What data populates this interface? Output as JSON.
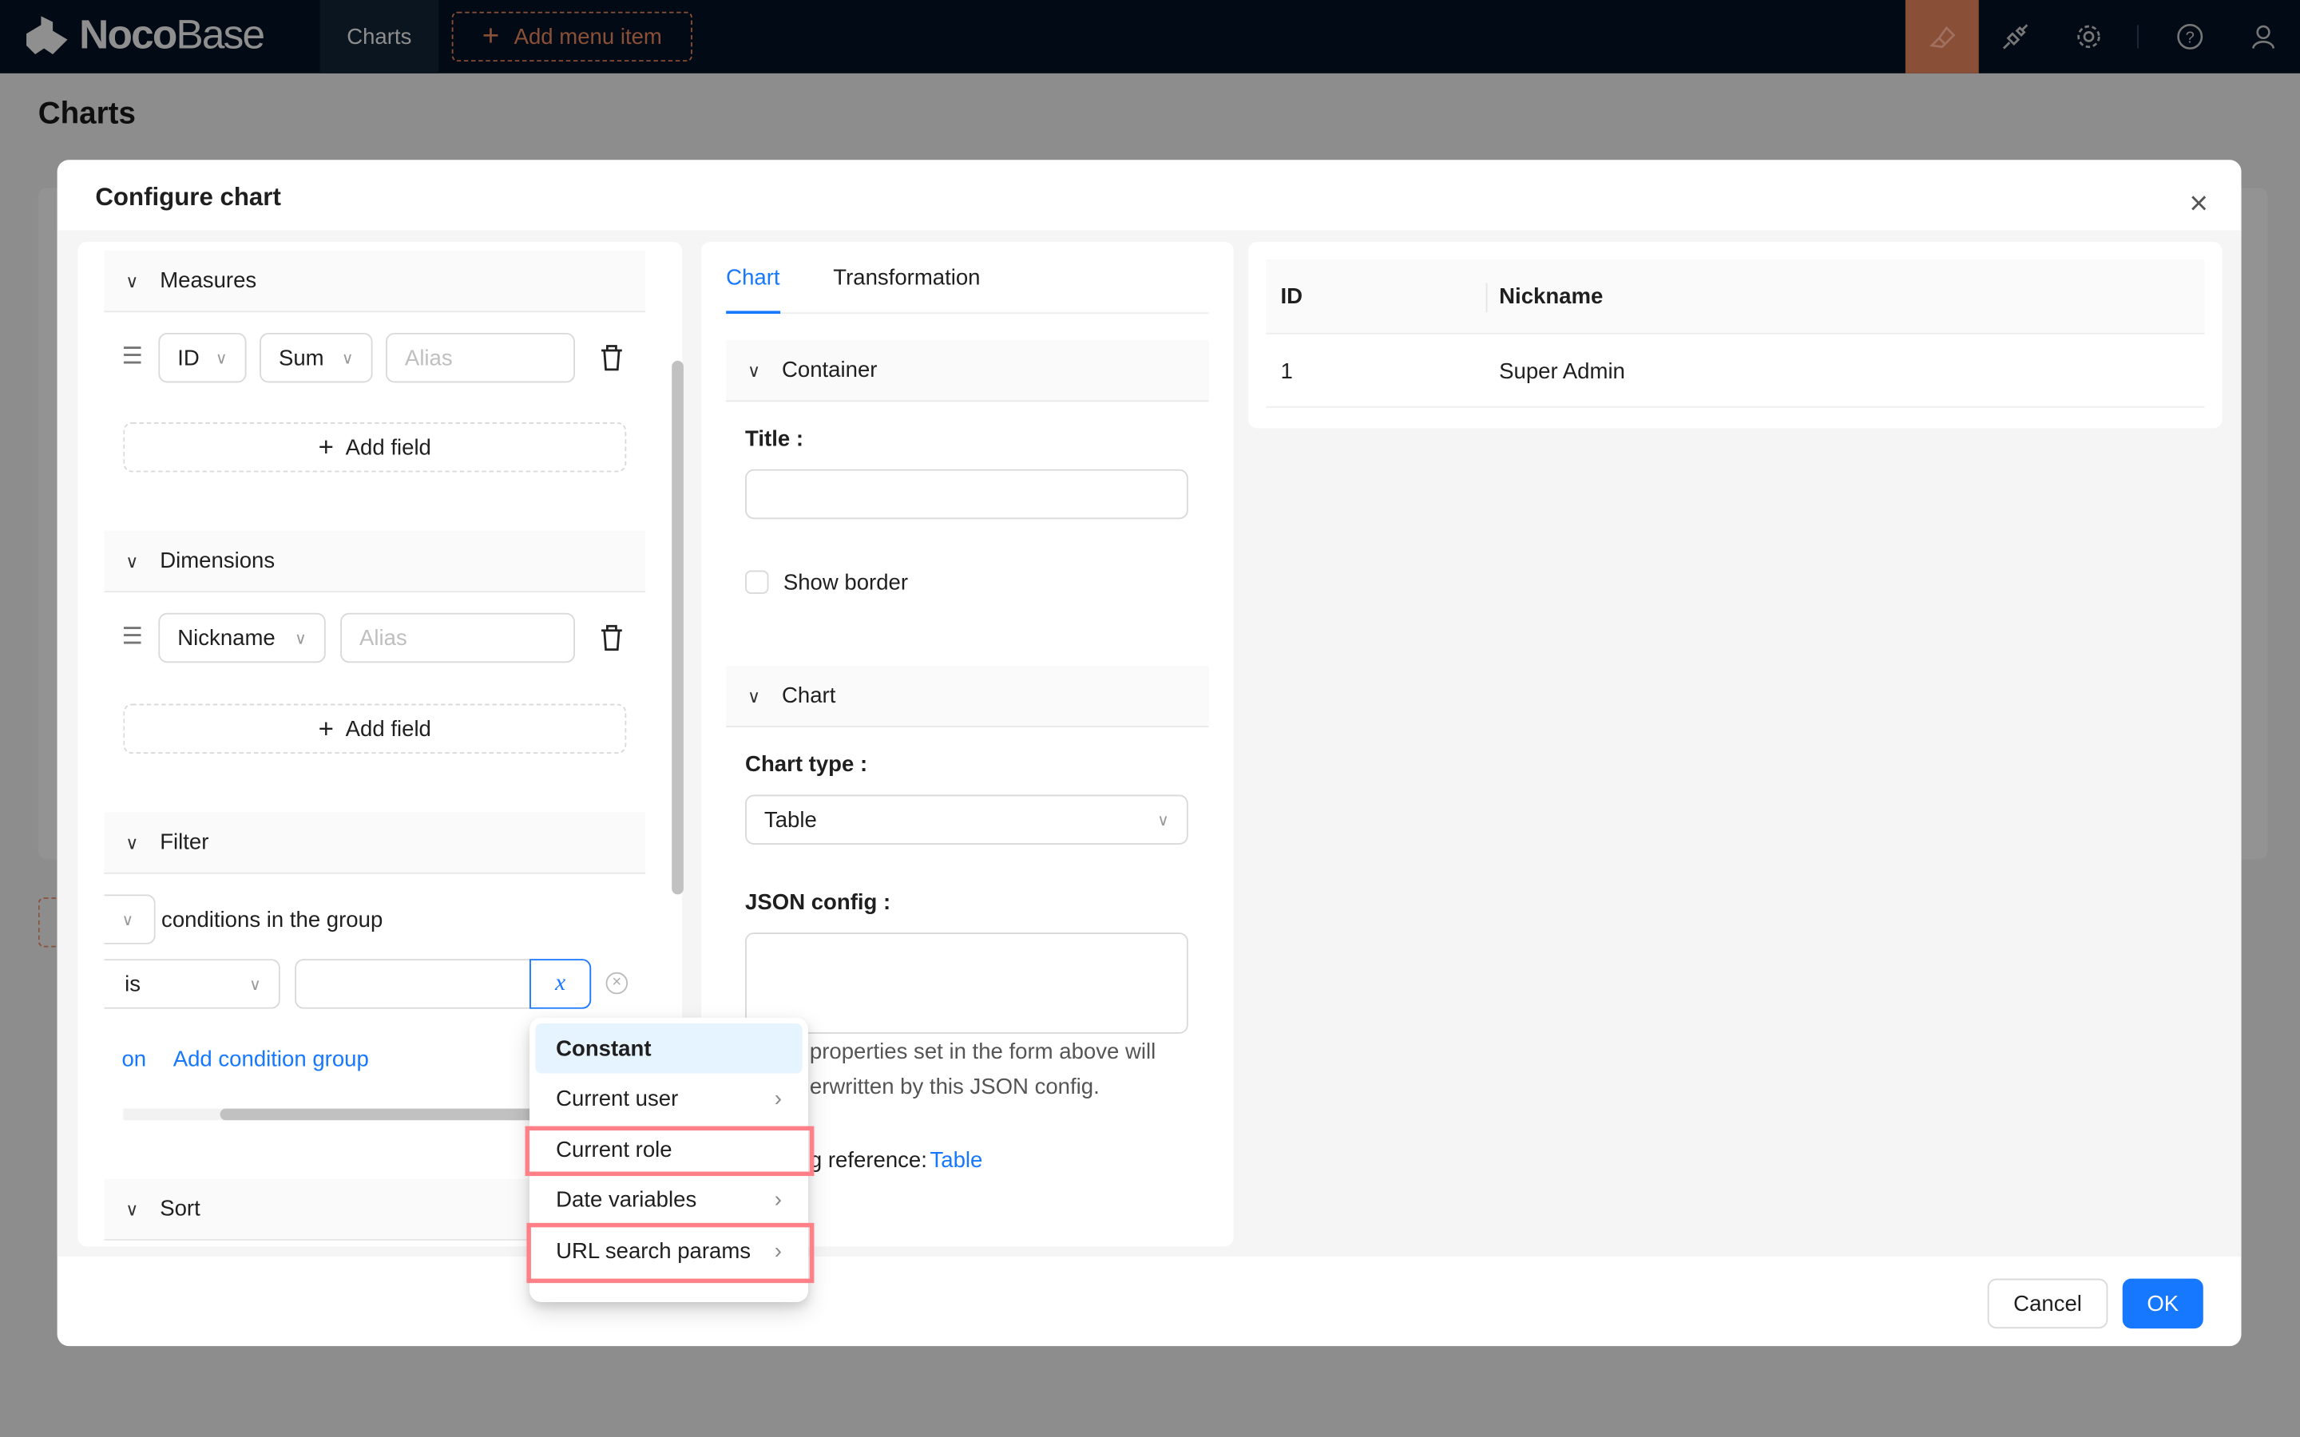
{
  "header": {
    "logo_bold": "Noco",
    "logo_light": "Base",
    "nav_item": "Charts",
    "add_menu_item": "Add menu item",
    "icons": [
      "highlighter-icon",
      "plugin-icon",
      "gear-icon",
      "help-icon",
      "user-icon"
    ],
    "accent": "#8a4f37"
  },
  "page": {
    "title": "Charts"
  },
  "modal": {
    "title": "Configure chart",
    "cancel": "Cancel",
    "ok": "OK",
    "left": {
      "measures": {
        "title": "Measures",
        "field": "ID",
        "aggregation": "Sum",
        "alias_placeholder": "Alias",
        "add_field": "Add field"
      },
      "dimensions": {
        "title": "Dimensions",
        "field": "Nickname",
        "alias_placeholder": "Alias",
        "add_field": "Add field"
      },
      "filter": {
        "title": "Filter",
        "group_text": "conditions in the group",
        "operator": "is",
        "value": "",
        "variable_button": "x",
        "add_condition_partial": "on",
        "add_condition_group": "Add condition group"
      },
      "sort": {
        "title": "Sort"
      }
    },
    "middle": {
      "tabs": [
        {
          "label": "Chart",
          "active": true
        },
        {
          "label": "Transformation",
          "active": false
        }
      ],
      "container": {
        "title": "Container",
        "title_label": "Title",
        "title_value": "",
        "show_border": "Show border",
        "show_border_checked": false
      },
      "chart": {
        "title": "Chart",
        "chart_type_label": "Chart type",
        "chart_type": "Table",
        "json_config_label": "JSON config",
        "json_config_value": "",
        "note_line1": "properties set in the form above will",
        "note_line2": "erwritten by this JSON config.",
        "ref_label": "g reference:",
        "ref_link": "Table"
      }
    },
    "preview": {
      "columns": [
        "ID",
        "Nickname"
      ],
      "rows": [
        [
          "1",
          "Super Admin"
        ]
      ]
    }
  },
  "variable_menu": {
    "items": [
      {
        "label": "Constant",
        "selected": true,
        "submenu": false
      },
      {
        "label": "Current user",
        "submenu": true
      },
      {
        "label": "Current role",
        "submenu": false,
        "highlighted": true
      },
      {
        "label": "Date variables",
        "submenu": true
      },
      {
        "label": "URL search params",
        "submenu": true,
        "highlighted": true
      }
    ],
    "highlight_color": "#ff8087"
  }
}
